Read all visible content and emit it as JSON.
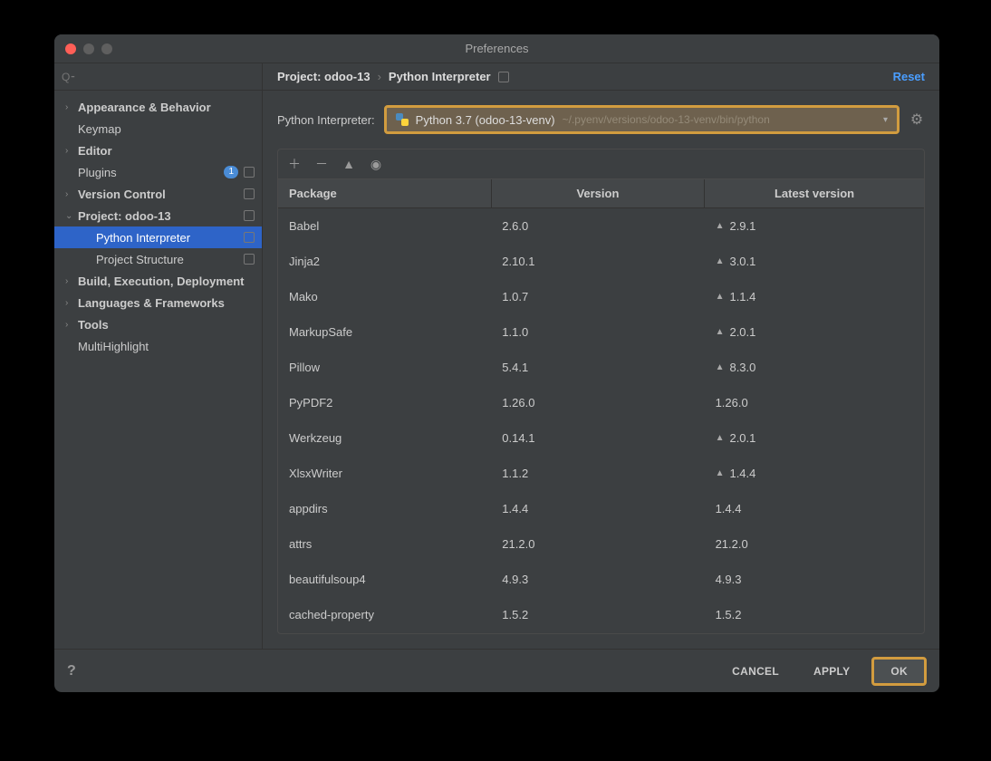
{
  "window": {
    "title": "Preferences"
  },
  "search": {
    "placeholder": "Q⁃"
  },
  "sidebar": {
    "items": [
      {
        "label": "Appearance & Behavior",
        "expandable": true,
        "level": 1
      },
      {
        "label": "Keymap",
        "level": 1,
        "leaf": true
      },
      {
        "label": "Editor",
        "expandable": true,
        "level": 1
      },
      {
        "label": "Plugins",
        "level": 1,
        "leaf": true,
        "badge": "1",
        "trailing_icon": true
      },
      {
        "label": "Version Control",
        "expandable": true,
        "level": 1,
        "trailing_icon": true
      },
      {
        "label": "Project: odoo-13",
        "expandable": true,
        "expanded": true,
        "level": 1,
        "trailing_icon": true
      },
      {
        "label": "Python Interpreter",
        "level": 2,
        "leaf": true,
        "selected": true,
        "trailing_icon": true
      },
      {
        "label": "Project Structure",
        "level": 2,
        "leaf": true,
        "trailing_icon": true
      },
      {
        "label": "Build, Execution, Deployment",
        "expandable": true,
        "level": 1
      },
      {
        "label": "Languages & Frameworks",
        "expandable": true,
        "level": 1
      },
      {
        "label": "Tools",
        "expandable": true,
        "level": 1
      },
      {
        "label": "MultiHighlight",
        "level": 1,
        "leaf": true
      }
    ]
  },
  "breadcrumb": {
    "items": [
      "Project: odoo-13",
      "Python Interpreter"
    ],
    "reset": "Reset"
  },
  "interpreter": {
    "label": "Python Interpreter:",
    "name": "Python 3.7 (odoo-13-venv)",
    "path": "~/.pyenv/versions/odoo-13-venv/bin/python"
  },
  "table": {
    "columns": [
      "Package",
      "Version",
      "Latest version"
    ],
    "rows": [
      {
        "pkg": "Babel",
        "ver": "2.6.0",
        "latest": "2.9.1",
        "upgrade": true
      },
      {
        "pkg": "Jinja2",
        "ver": "2.10.1",
        "latest": "3.0.1",
        "upgrade": true
      },
      {
        "pkg": "Mako",
        "ver": "1.0.7",
        "latest": "1.1.4",
        "upgrade": true
      },
      {
        "pkg": "MarkupSafe",
        "ver": "1.1.0",
        "latest": "2.0.1",
        "upgrade": true
      },
      {
        "pkg": "Pillow",
        "ver": "5.4.1",
        "latest": "8.3.0",
        "upgrade": true
      },
      {
        "pkg": "PyPDF2",
        "ver": "1.26.0",
        "latest": "1.26.0",
        "upgrade": false
      },
      {
        "pkg": "Werkzeug",
        "ver": "0.14.1",
        "latest": "2.0.1",
        "upgrade": true
      },
      {
        "pkg": "XlsxWriter",
        "ver": "1.1.2",
        "latest": "1.4.4",
        "upgrade": true
      },
      {
        "pkg": "appdirs",
        "ver": "1.4.4",
        "latest": "1.4.4",
        "upgrade": false
      },
      {
        "pkg": "attrs",
        "ver": "21.2.0",
        "latest": "21.2.0",
        "upgrade": false
      },
      {
        "pkg": "beautifulsoup4",
        "ver": "4.9.3",
        "latest": "4.9.3",
        "upgrade": false
      },
      {
        "pkg": "cached-property",
        "ver": "1.5.2",
        "latest": "1.5.2",
        "upgrade": false
      }
    ]
  },
  "footer": {
    "help": "?",
    "cancel": "CANCEL",
    "apply": "APPLY",
    "ok": "OK"
  }
}
